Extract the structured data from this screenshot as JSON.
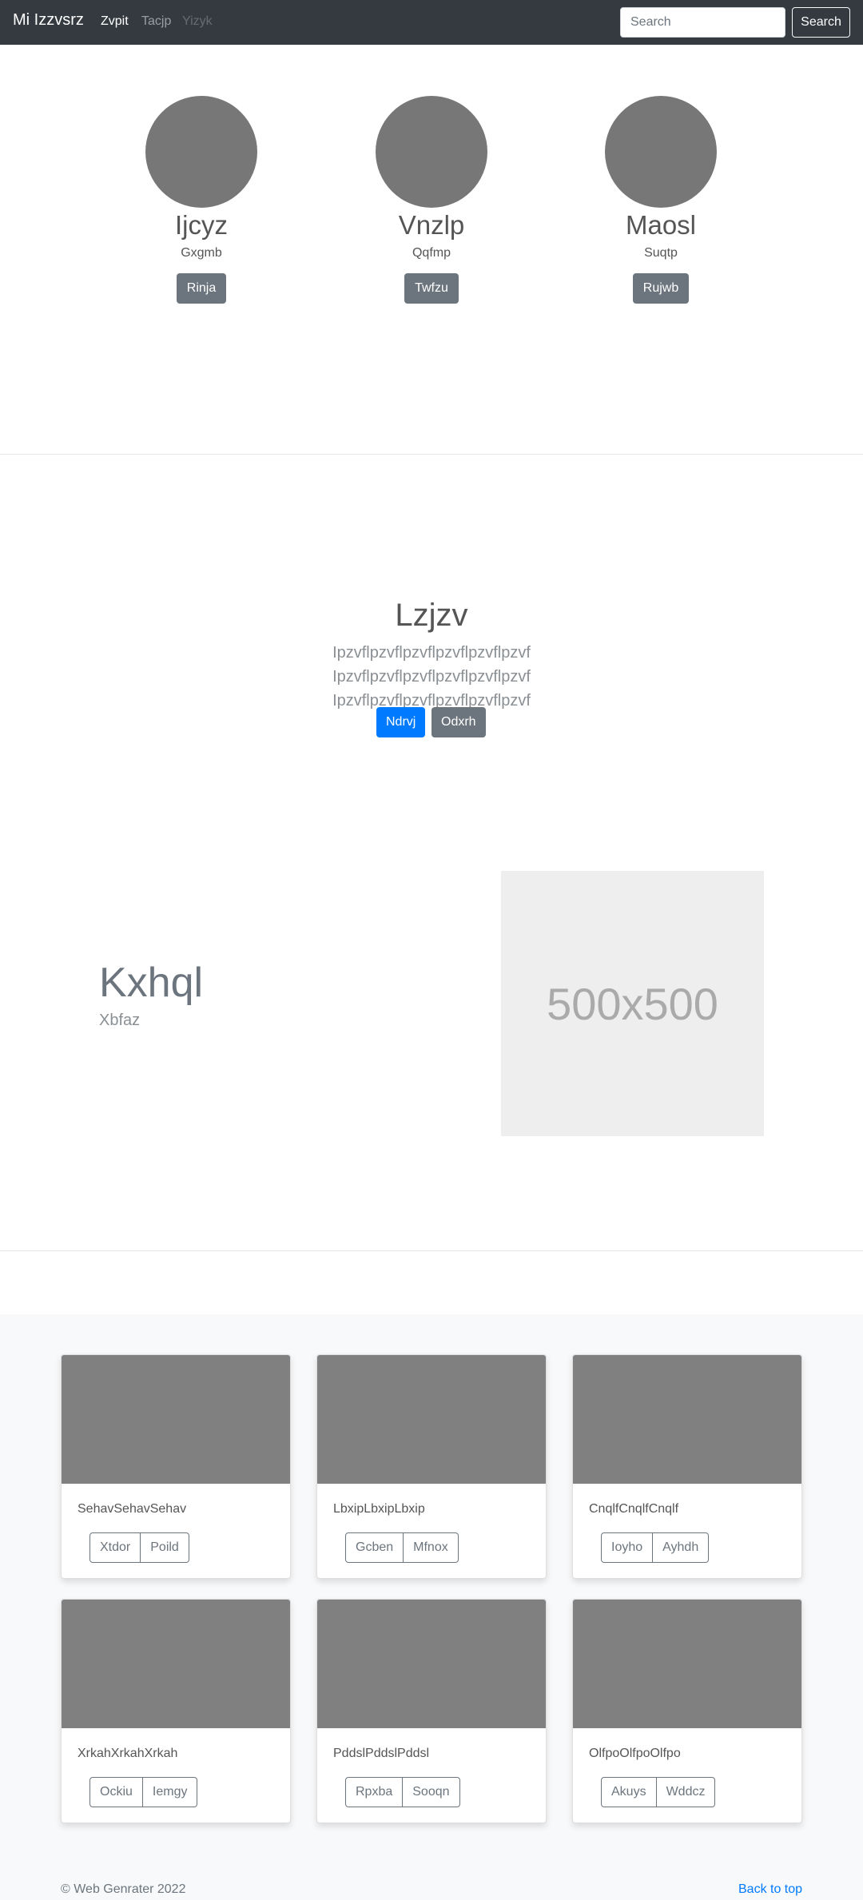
{
  "navbar": {
    "brand": "Mi Izzvsrz",
    "links": [
      "Zvpit",
      "Tacjp",
      "Yizyk"
    ],
    "search_placeholder": "Search",
    "search_button": "Search"
  },
  "profiles": [
    {
      "name": "Ijcyz",
      "subtitle": "Gxgmb",
      "button": "Rinja"
    },
    {
      "name": "Vnzlp",
      "subtitle": "Qqfmp",
      "button": "Twfzu"
    },
    {
      "name": "Maosl",
      "subtitle": "Suqtp",
      "button": "Rujwb"
    }
  ],
  "jumbotron": {
    "title": "Lzjzv",
    "text": "Ipzvflpzvflpzvflpzvflpzvflpzvf Ipzvflpzvflpzvflpzvflpzvflpzvf Ipzvflpzvflpzvflpzvflpzvflpzvf",
    "primary_button": "Ndrvj",
    "secondary_button": "Odxrh"
  },
  "feature": {
    "title": "Kxhql",
    "subtitle": "Xbfaz",
    "image_label": "500x500"
  },
  "cards": [
    {
      "text": "SehavSehavSehav",
      "buttons": [
        "Xtdor",
        "Poild"
      ]
    },
    {
      "text": "LbxipLbxipLbxip",
      "buttons": [
        "Gcben",
        "Mfnox"
      ]
    },
    {
      "text": "CnqlfCnqlfCnqlf",
      "buttons": [
        "Ioyho",
        "Ayhdh"
      ]
    },
    {
      "text": "XrkahXrkahXrkah",
      "buttons": [
        "Ockiu",
        "Iemgy"
      ]
    },
    {
      "text": "PddslPddslPddsl",
      "buttons": [
        "Rpxba",
        "Sooqn"
      ]
    },
    {
      "text": "OlfpoOlfpoOlfpo",
      "buttons": [
        "Akuys",
        "Wddcz"
      ]
    }
  ],
  "footer": {
    "copyright": "© Web Genrater 2022",
    "back_to_top": "Back to top"
  },
  "colors": {
    "navbar_bg": "#343a40",
    "primary": "#007bff",
    "secondary": "#6c757d",
    "placeholder_gray": "#777777"
  }
}
